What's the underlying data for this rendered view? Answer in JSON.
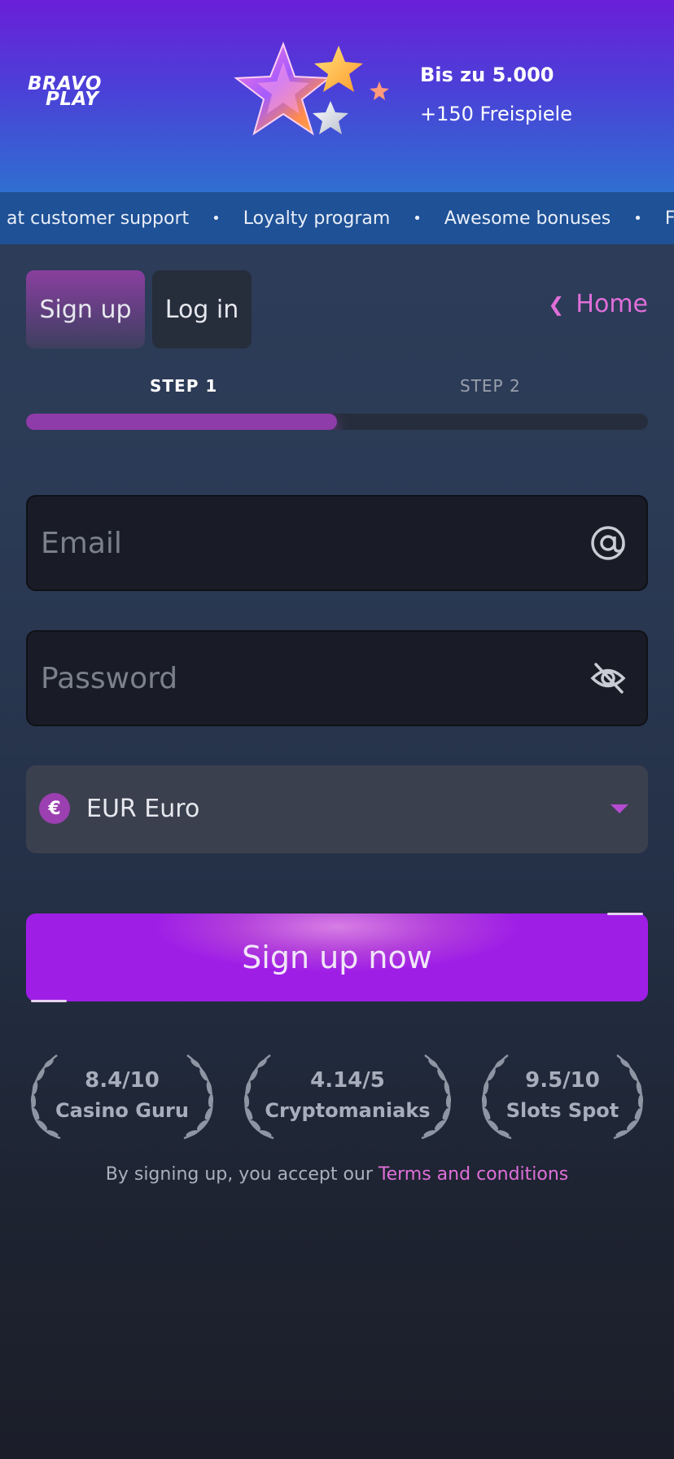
{
  "banner": {
    "logo_line1": "BRAVO",
    "logo_line2": "PLAY",
    "promo_line1": "Bis zu 5.000",
    "promo_line2": "+150 Freispiele"
  },
  "ticker": {
    "items": [
      "at customer support",
      "Loyalty program",
      "Awesome bonuses",
      "Fas"
    ],
    "separator": "•"
  },
  "tabs": {
    "signup": "Sign up",
    "login": "Log in",
    "home": "Home"
  },
  "steps": {
    "step1": "STEP 1",
    "step2": "STEP 2",
    "progress_fraction": 0.5
  },
  "form": {
    "email_placeholder": "Email",
    "password_placeholder": "Password",
    "currency_symbol": "€",
    "currency_value": "EUR Euro",
    "submit_label": "Sign up now"
  },
  "ratings": [
    {
      "score": "8.4/10",
      "source": "Casino Guru"
    },
    {
      "score": "4.14/5",
      "source": "Cryptomaniaks"
    },
    {
      "score": "9.5/10",
      "source": "Slots Spot"
    }
  ],
  "terms": {
    "prefix": "By signing up, you accept our ",
    "link": "Terms and conditions"
  },
  "colors": {
    "accent": "#e06fd9",
    "cta": "#a31de8",
    "progress": "#8e3ca9"
  }
}
